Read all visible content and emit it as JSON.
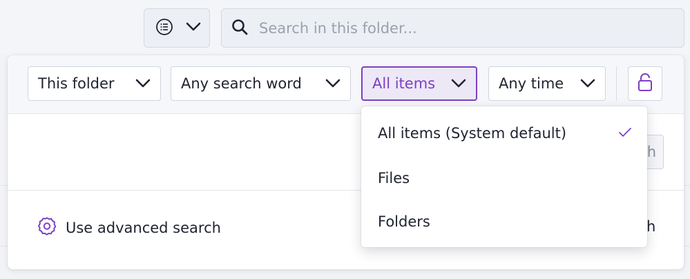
{
  "colors": {
    "accent": "#7d3fc4",
    "accent_bg": "#ede8f6",
    "text": "#1f2330",
    "muted": "#9aa1ae"
  },
  "toolbar": {
    "view_toggle_icon": "list-icon",
    "view_toggle_chevron": "chevron-down-icon",
    "search_icon": "search-icon",
    "search_placeholder": "Search in this folder..."
  },
  "filters": [
    {
      "label": "This folder",
      "icon": "chevron-down-icon",
      "active": false
    },
    {
      "label": "Any search word",
      "icon": "chevron-down-icon",
      "active": false
    },
    {
      "label": "All items",
      "icon": "chevron-down-icon",
      "active": true
    },
    {
      "label": "Any time",
      "icon": "chevron-down-icon",
      "active": false
    }
  ],
  "lock_icon": "unlock-icon",
  "panel": {
    "partial_button_text": "h",
    "partial_right_text": "h",
    "advanced_search_label": "Use advanced search",
    "advanced_search_icon": "gear-icon"
  },
  "dropdown": {
    "items": [
      {
        "label": "All items (System default)",
        "selected": true
      },
      {
        "label": "Files",
        "selected": false
      },
      {
        "label": "Folders",
        "selected": false
      }
    ],
    "check_icon": "check-icon"
  }
}
